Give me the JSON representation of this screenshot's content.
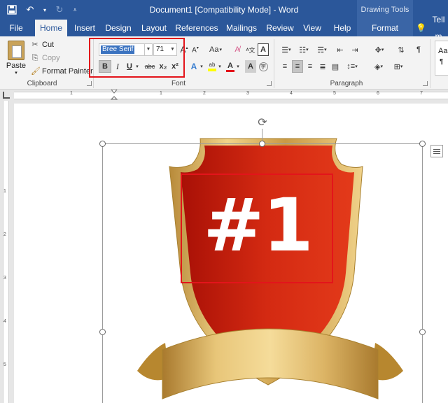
{
  "window": {
    "title": "Document1 [Compatibility Mode]  -  Word",
    "context_tab_header": "Drawing Tools"
  },
  "tabs": [
    "File",
    "Home",
    "Insert",
    "Design",
    "Layout",
    "References",
    "Mailings",
    "Review",
    "View",
    "Help",
    "Format",
    "Tell m"
  ],
  "active_tab": "Home",
  "clipboard": {
    "paste_label": "Paste",
    "cut_label": "Cut",
    "copy_label": "Copy",
    "format_painter_label": "Format Painter",
    "group_label": "Clipboard"
  },
  "font": {
    "font_name": "Bree Serif",
    "font_size": "71",
    "group_label": "Font",
    "change_case": "Aa",
    "bold": "B",
    "italic": "I",
    "underline": "U",
    "strikethrough": "abc",
    "subscript": "x₂",
    "superscript": "x²",
    "text_effects": "A",
    "font_color": "A",
    "highlight": "ab"
  },
  "paragraph": {
    "group_label": "Paragraph"
  },
  "styles": {
    "preview": "Aa",
    "preview_sub": "¶"
  },
  "document": {
    "badge_text": "#1"
  },
  "ruler": {
    "h_ticks": [
      "1",
      "1",
      "2",
      "3",
      "4",
      "5",
      "6",
      "7"
    ],
    "v_ticks": [
      "1",
      "2",
      "3",
      "4",
      "5"
    ]
  },
  "colors": {
    "accent": "#2b579a",
    "shield_red": "#d42a12",
    "gold": "#d9b25a",
    "highlight_red": "#e3141b"
  }
}
